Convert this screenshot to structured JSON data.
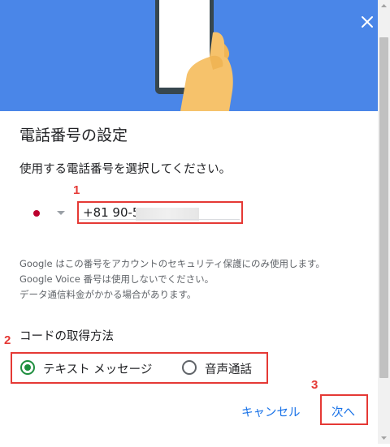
{
  "dialog": {
    "title": "電話番号の設定",
    "subtitle": "使用する電話番号を選択してください。",
    "close_icon": "close-icon",
    "banner_icon": "hand-holding-phone-illustration"
  },
  "phone": {
    "country_flag": "japan-flag-icon",
    "value": "+81 90-5"
  },
  "info_lines": [
    "Google はこの番号をアカウントのセキュリティ保護にのみ使用します。",
    "Google Voice 番号は使用しないでください。",
    "データ通信料金がかかる場合があります。"
  ],
  "code_method": {
    "title": "コードの取得方法",
    "options": [
      {
        "label": "テキスト メッセージ",
        "selected": true
      },
      {
        "label": "音声通話",
        "selected": false
      }
    ]
  },
  "actions": {
    "cancel_label": "キャンセル",
    "next_label": "次へ"
  },
  "annotations": {
    "marker1": "1",
    "marker2": "2",
    "marker3": "3"
  },
  "colors": {
    "banner": "#4a86e8",
    "accent": "#1a73e8",
    "selected_radio": "#1e8e3e",
    "highlight": "#e53935"
  }
}
